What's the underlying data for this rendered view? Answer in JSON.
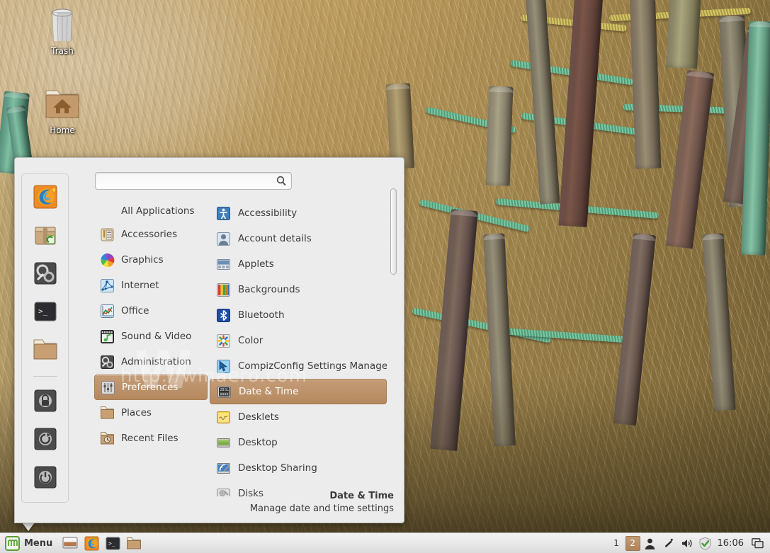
{
  "desktop": {
    "icons": [
      {
        "name": "trash",
        "label": "Trash"
      },
      {
        "name": "home",
        "label": "Home"
      }
    ]
  },
  "watermark": {
    "big": "W",
    "url": "http://winaero.com"
  },
  "menu": {
    "search": {
      "value": "",
      "placeholder": "",
      "icon": "search-icon"
    },
    "favorites": [
      {
        "name": "firefox",
        "label": "Firefox Web Browser"
      },
      {
        "name": "software-manager",
        "label": "Software Manager"
      },
      {
        "name": "system-settings",
        "label": "System Settings"
      },
      {
        "name": "terminal",
        "label": "Terminal"
      },
      {
        "name": "files",
        "label": "Files"
      },
      {
        "name": "lock-screen",
        "label": "Lock Screen"
      },
      {
        "name": "logout",
        "label": "Logout"
      },
      {
        "name": "quit",
        "label": "Quit"
      }
    ],
    "categories": [
      {
        "label": "All Applications",
        "icon": "",
        "selected": false,
        "header": true
      },
      {
        "label": "Accessories",
        "icon": "accessories-icon",
        "selected": false
      },
      {
        "label": "Graphics",
        "icon": "graphics-icon",
        "selected": false
      },
      {
        "label": "Internet",
        "icon": "internet-icon",
        "selected": false
      },
      {
        "label": "Office",
        "icon": "office-icon",
        "selected": false
      },
      {
        "label": "Sound & Video",
        "icon": "sound-video-icon",
        "selected": false
      },
      {
        "label": "Administration",
        "icon": "administration-icon",
        "selected": false
      },
      {
        "label": "Preferences",
        "icon": "preferences-icon",
        "selected": true
      },
      {
        "label": "Places",
        "icon": "places-icon",
        "selected": false
      },
      {
        "label": "Recent Files",
        "icon": "recent-files-icon",
        "selected": false
      }
    ],
    "applications": [
      {
        "label": "Accessibility",
        "icon": "accessibility-icon",
        "selected": false
      },
      {
        "label": "Account details",
        "icon": "account-details-icon",
        "selected": false
      },
      {
        "label": "Applets",
        "icon": "applets-icon",
        "selected": false
      },
      {
        "label": "Backgrounds",
        "icon": "backgrounds-icon",
        "selected": false
      },
      {
        "label": "Bluetooth",
        "icon": "bluetooth-icon",
        "selected": false
      },
      {
        "label": "Color",
        "icon": "color-icon",
        "selected": false
      },
      {
        "label": "CompizConfig Settings Manager",
        "icon": "compizconfig-icon",
        "selected": false
      },
      {
        "label": "Date & Time",
        "icon": "date-time-icon",
        "selected": true
      },
      {
        "label": "Desklets",
        "icon": "desklets-icon",
        "selected": false
      },
      {
        "label": "Desktop",
        "icon": "desktop-icon",
        "selected": false
      },
      {
        "label": "Desktop Sharing",
        "icon": "desktop-sharing-icon",
        "selected": false
      },
      {
        "label": "Disks",
        "icon": "disks-icon",
        "selected": false
      }
    ],
    "status": {
      "title": "Date & Time",
      "description": "Manage date and time settings"
    },
    "accent_color": "#b5895f"
  },
  "taskbar": {
    "menu_label": "Menu",
    "launchers": [
      {
        "name": "show-desktop",
        "label": "Show Desktop"
      },
      {
        "name": "firefox",
        "label": "Firefox Web Browser"
      },
      {
        "name": "terminal",
        "label": "Terminal"
      },
      {
        "name": "files",
        "label": "Files"
      }
    ],
    "workspaces": [
      {
        "label": "1",
        "active": false
      },
      {
        "label": "2",
        "active": true
      }
    ],
    "tray": [
      {
        "name": "user-icon",
        "label": "User"
      },
      {
        "name": "keyboard-layout-icon",
        "label": "Keyboard layout"
      },
      {
        "name": "volume-icon",
        "label": "Volume"
      },
      {
        "name": "update-shield-icon",
        "label": "Update Manager"
      }
    ],
    "clock": "16:06",
    "show_desktop_label": "Show desktop"
  }
}
